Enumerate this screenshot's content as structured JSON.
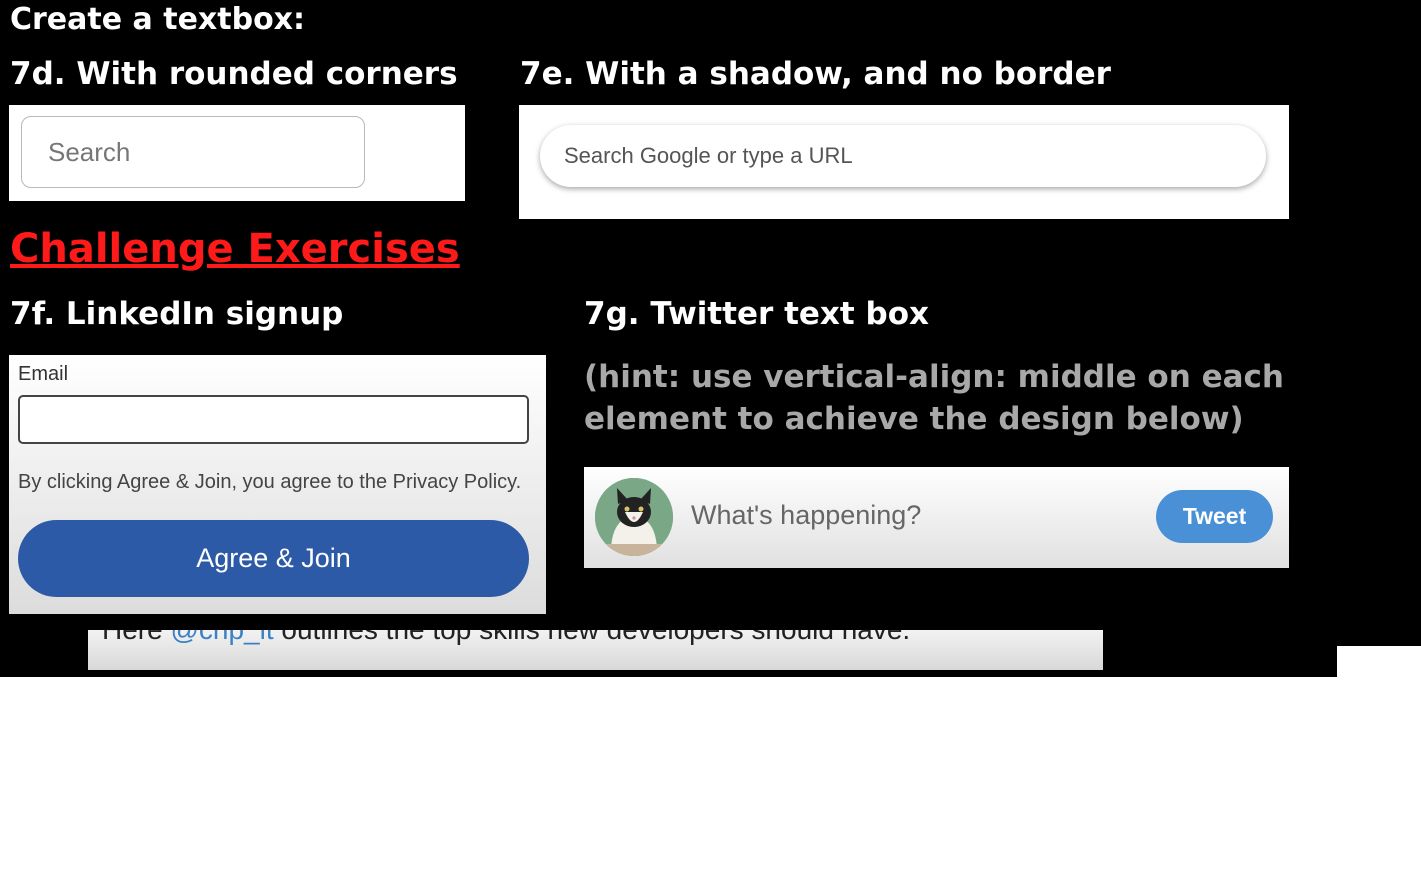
{
  "header": {
    "title": "Create a textbox:"
  },
  "ex7d": {
    "heading": "7d. With rounded corners",
    "placeholder": "Search"
  },
  "ex7e": {
    "heading": "7e. With a shadow, and no border",
    "placeholder": "Search Google or type a URL"
  },
  "challenge": {
    "heading": "Challenge Exercises",
    "color": "#ff1a1a"
  },
  "ex7f": {
    "heading": "7f. LinkedIn signup",
    "email_label": "Email",
    "email_value": "",
    "policy_text": "By clicking Agree & Join, you agree to the Privacy Policy.",
    "button_label": "Agree & Join",
    "button_color": "#2d5aa6"
  },
  "ex7g": {
    "heading": "7g. Twitter text box",
    "hint": "(hint: use vertical-align: middle on each element to achieve the design below)",
    "placeholder": "What's happening?",
    "button_label": "Tweet",
    "button_color": "#4a90d6",
    "avatar_icon": "cat-avatar-icon"
  },
  "caption": {
    "prefix": "Here ",
    "mention": "@chp_it",
    "suffix": " outlines the top skills new developers should have."
  }
}
